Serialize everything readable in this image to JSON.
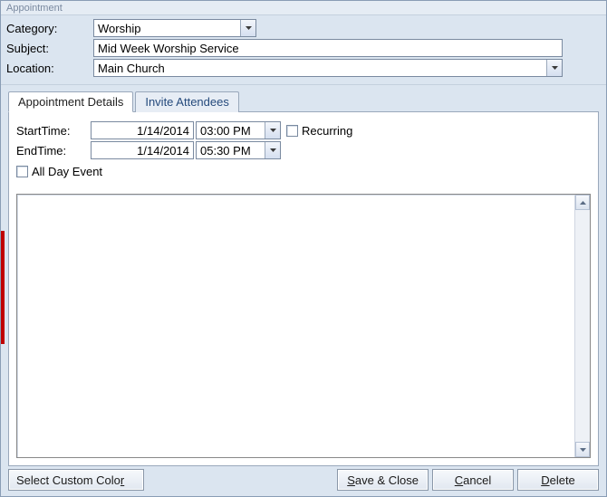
{
  "window": {
    "title": "Appointment"
  },
  "header": {
    "category_label": "Category:",
    "category_value": "Worship",
    "subject_label": "Subject:",
    "subject_value": "Mid Week Worship Service",
    "location_label": "Location:",
    "location_value": "Main Church"
  },
  "tabs": {
    "details": "Appointment Details",
    "invite": "Invite Attendees"
  },
  "details": {
    "start_label": "StartTime:",
    "start_date": "1/14/2014",
    "start_time": "03:00 PM",
    "end_label": "EndTime:",
    "end_date": "1/14/2014",
    "end_time": "05:30 PM",
    "recurring_label": "Recurring",
    "allday_label": "All Day Event"
  },
  "footer": {
    "custom_color_prefix": "Select Custom Colo",
    "custom_color_ul": "r",
    "save_ul": "S",
    "save_suffix": "ave & Close",
    "cancel_ul": "C",
    "cancel_suffix": "ancel",
    "delete_ul": "D",
    "delete_suffix": "elete"
  }
}
